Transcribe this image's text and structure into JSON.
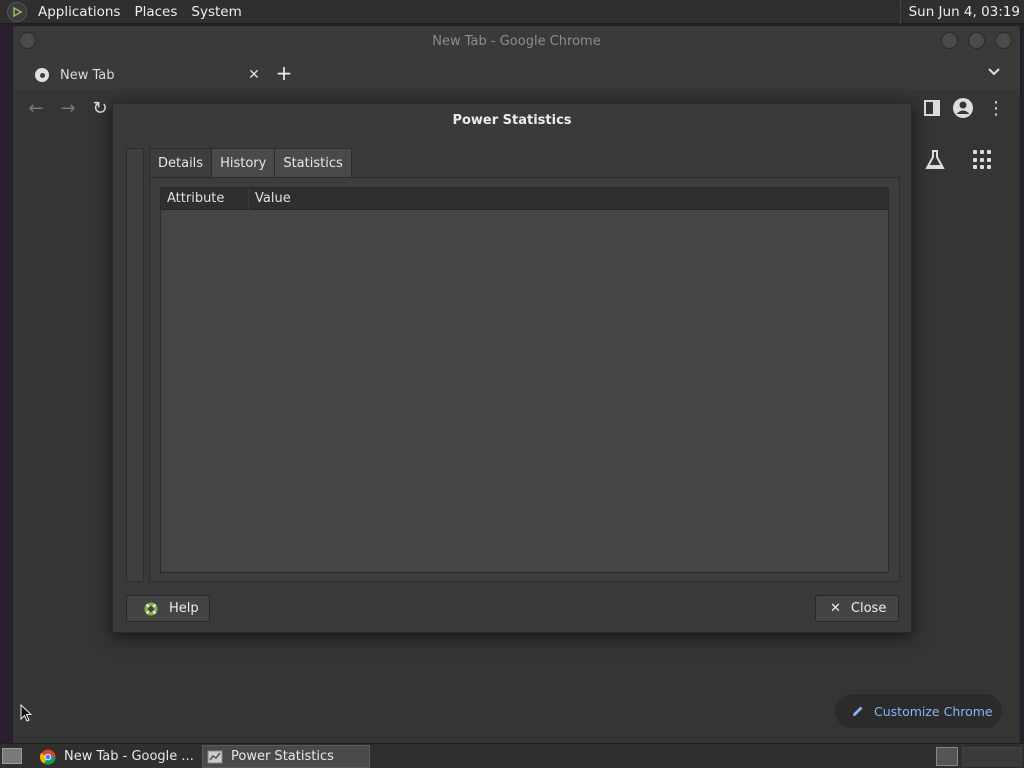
{
  "top_panel": {
    "menus": [
      "Applications",
      "Places",
      "System"
    ],
    "clock": "Sun Jun  4, 03:19"
  },
  "chrome": {
    "window_title": "New Tab - Google Chrome",
    "tab_label": "New Tab",
    "customize_label": "Customize Chrome",
    "accent_color": "#8ab4f8"
  },
  "dialog": {
    "title": "Power Statistics",
    "tabs": [
      "Details",
      "History",
      "Statistics"
    ],
    "active_tab": "Details",
    "columns": [
      "Attribute",
      "Value"
    ],
    "help_label": "Help",
    "close_label": "Close"
  },
  "taskbar": {
    "items": [
      "New Tab - Google ...",
      "Power Statistics"
    ]
  }
}
